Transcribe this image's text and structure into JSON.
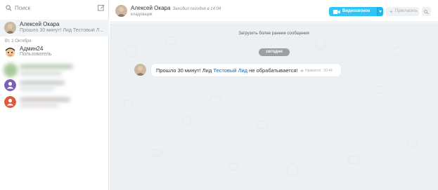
{
  "sidebar": {
    "search_placeholder": "Поиск",
    "chats": [
      {
        "name": "Алексей Окара",
        "preview": "Прошло 30 минут! Лид Тестовый Л..."
      },
      {
        "name": "Админ24",
        "preview": "Пользователь"
      }
    ],
    "date_separator": "Вт, 1 Октября"
  },
  "header": {
    "name": "Алексей Окара",
    "status": "Заходил сегодня в 14:04",
    "role": "кладовщик",
    "video_button": "Видеозвонок",
    "invite_button": "Пригласить"
  },
  "chat": {
    "load_more": "Загрузить более ранние сообщения",
    "today": "сегодня",
    "message": {
      "text_before": "Прошло 30 минут! Лид ",
      "link": "Тестовый Лид",
      "text_after": " не обрабатывается!",
      "like_label": "Нравится",
      "time": "20:44"
    }
  },
  "colors": {
    "accent": "#2fc6f6",
    "link": "#2067b0",
    "chat_bg": "#edf0f3",
    "badge": "#9aa0a6",
    "avatar_purple": "#7b5fb8",
    "avatar_orange": "#e0593a"
  },
  "icons": {
    "search": "search-icon",
    "compose": "compose-icon",
    "video": "video-camera-icon",
    "invite": "plus-icon",
    "more": "more-icon",
    "like": "like-icon"
  }
}
